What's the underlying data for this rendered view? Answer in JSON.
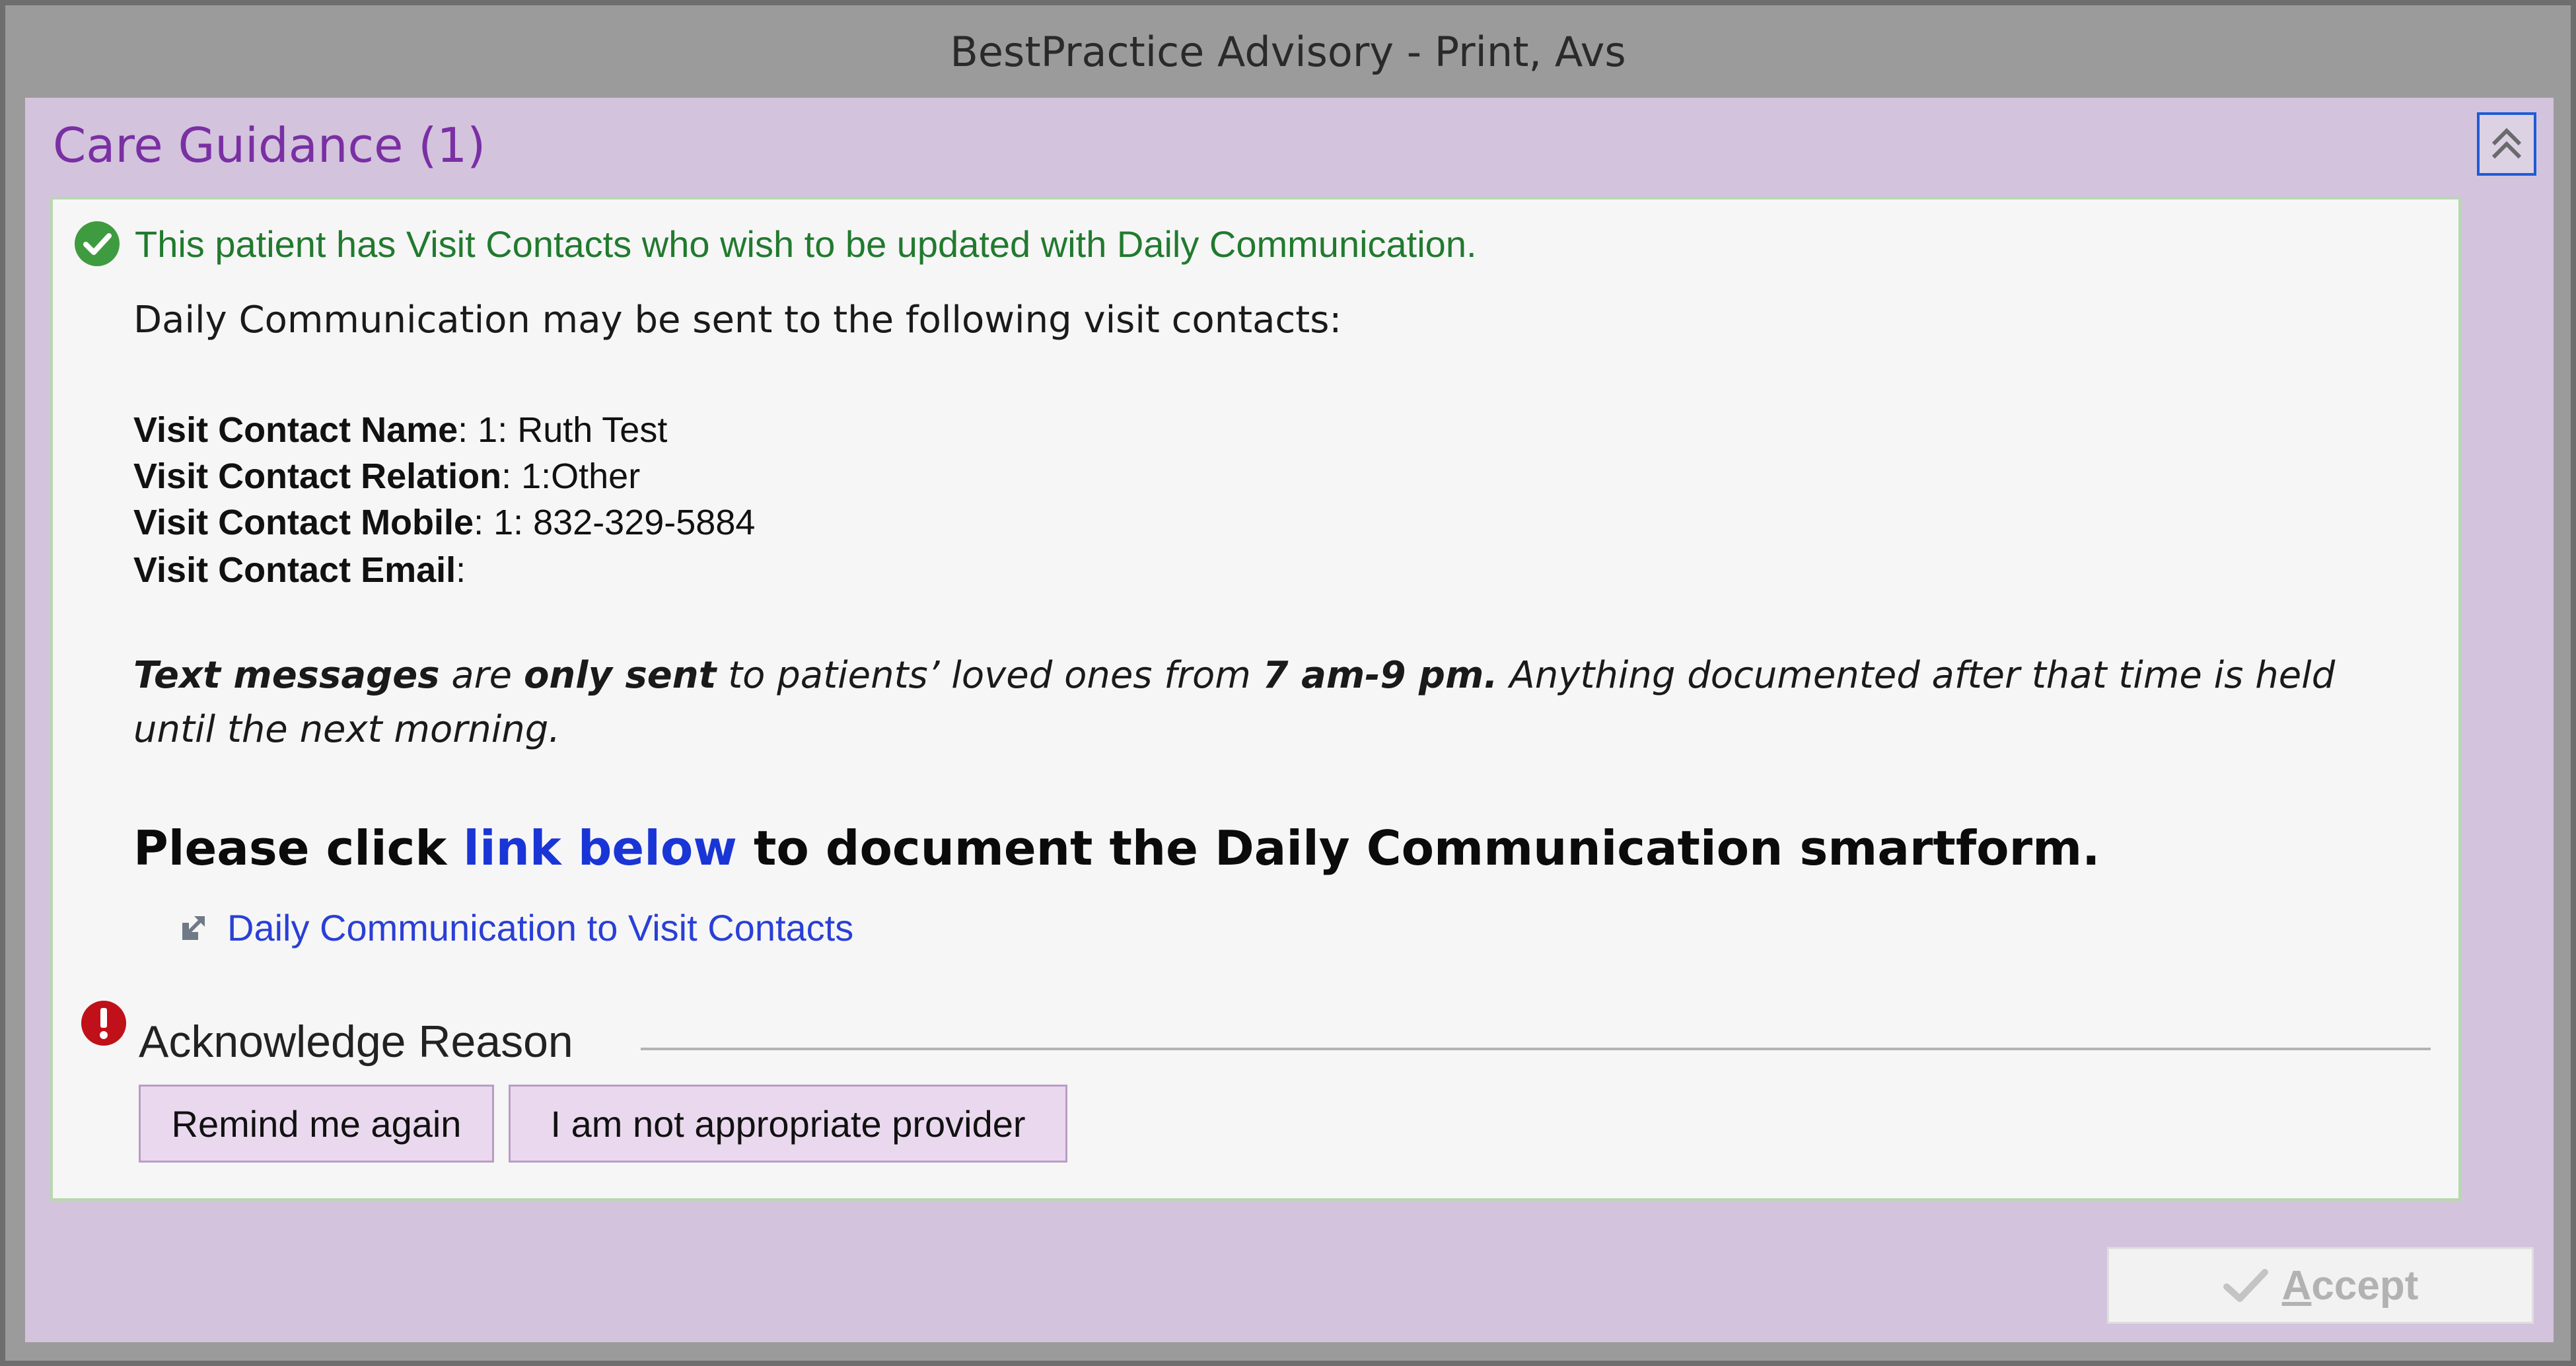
{
  "window": {
    "title": "BestPractice Advisory - Print, Avs"
  },
  "section": {
    "title": "Care Guidance (1)"
  },
  "advisory": {
    "status": "This patient has Visit Contacts who wish to be updated with Daily Communication.",
    "intro": "Daily Communication may be sent to the following visit contacts:",
    "fields": {
      "name_label": "Visit Contact Name",
      "name_value": ": 1: Ruth Test",
      "relation_label": "Visit Contact Relation",
      "relation_value": ": 1:Other",
      "mobile_label": "Visit Contact Mobile",
      "mobile_value": ": 1: 832-329-5884",
      "email_label": "Visit Contact Email",
      "email_value": ":"
    },
    "notice": {
      "p1": "Text messages",
      "p2": " are ",
      "p3": "only sent",
      "p4": " to patients’ loved ones from ",
      "p5": "7 am-9 pm.",
      "p6": " Anything documented after that time is held until the next morning."
    },
    "cta": {
      "before": "Please click ",
      "link": "link below",
      "after": " to document the Daily Communication smartform."
    },
    "smartform_link": "Daily Communication to Visit Contacts"
  },
  "acknowledge": {
    "label": "Acknowledge Reason",
    "reasons": [
      "Remind me again",
      "I am not appropriate provider"
    ]
  },
  "footer": {
    "accept_first": "A",
    "accept_rest": "ccept"
  },
  "colors": {
    "panel": "#d3c3dd",
    "title_purple": "#7a2fa3",
    "status_green": "#217a2e",
    "link_blue": "#1a35d6",
    "warning_red": "#c0101a"
  },
  "icons": [
    "chevron-up-double-icon",
    "check-circle-icon",
    "external-link-arrow-icon",
    "exclamation-circle-icon",
    "checkmark-icon"
  ]
}
